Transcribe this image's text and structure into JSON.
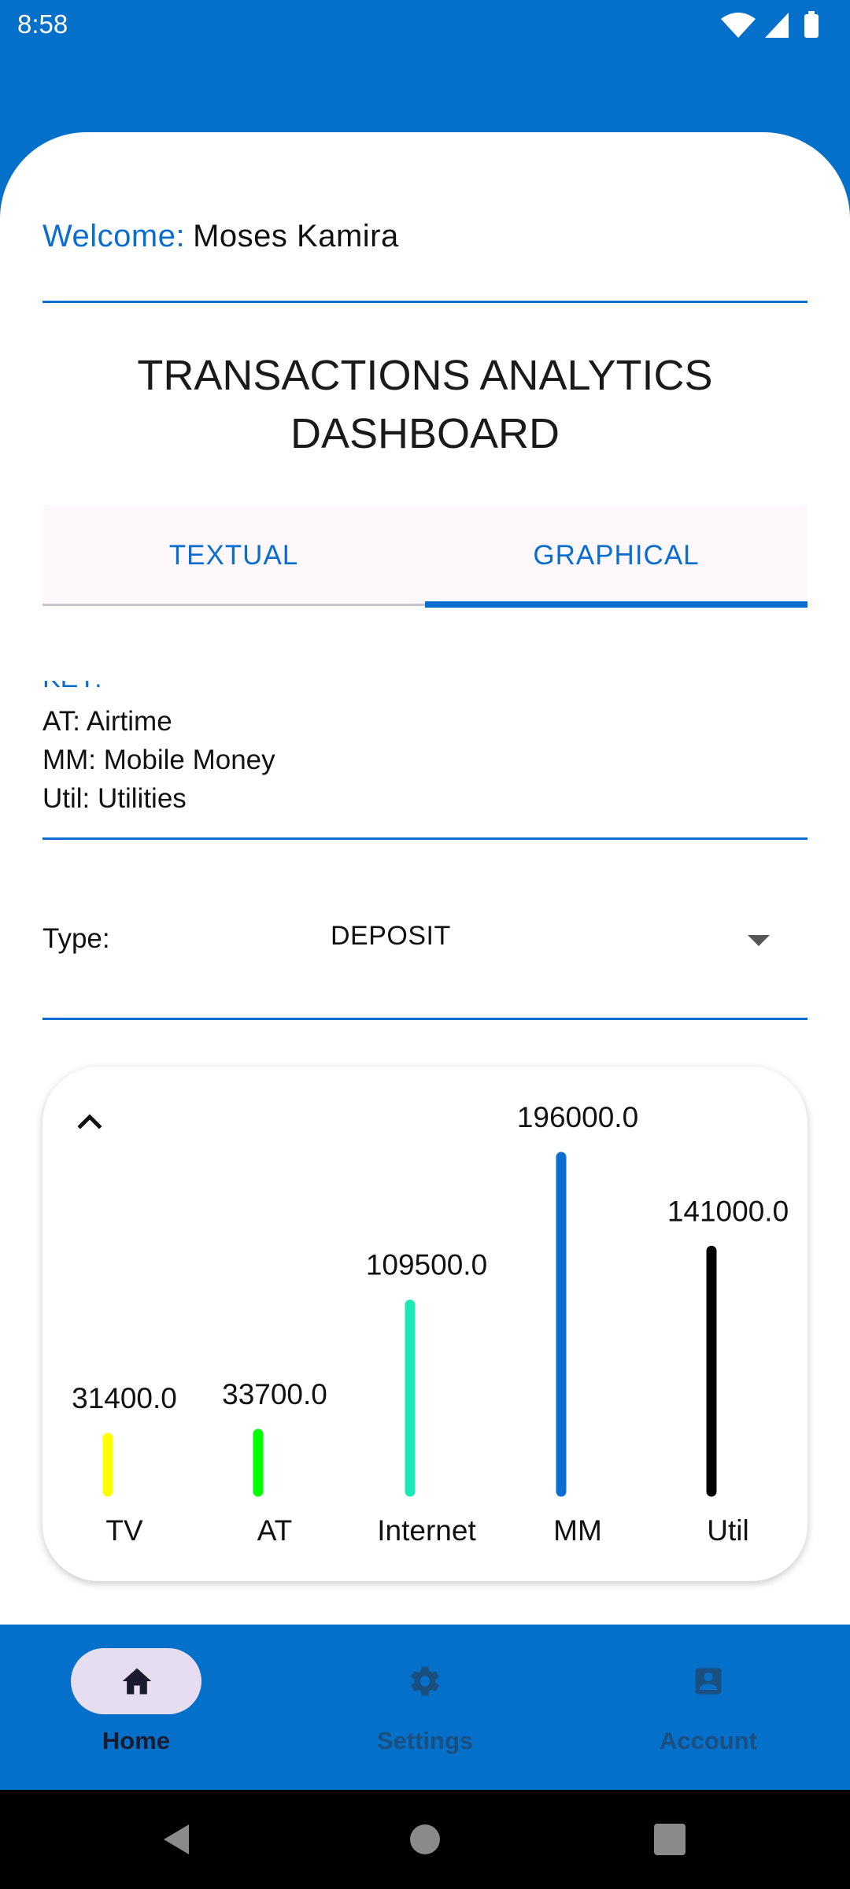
{
  "status_bar": {
    "time": "8:58",
    "icons": [
      "wifi-icon",
      "signal-icon",
      "battery-icon"
    ]
  },
  "header": {
    "welcome_label": "Welcome:",
    "user_name": "Moses Kamira"
  },
  "dashboard": {
    "title": "TRANSACTIONS ANALYTICS\nDASHBOARD"
  },
  "tabs": [
    {
      "label": "TEXTUAL",
      "selected": false
    },
    {
      "label": "GRAPHICAL",
      "selected": true
    }
  ],
  "key": {
    "title": "KEY:",
    "lines": [
      "AT: Airtime",
      "MM: Mobile Money",
      "Util: Utilities"
    ]
  },
  "type_filter": {
    "label": "Type:",
    "value": "DEPOSIT"
  },
  "chart_data": {
    "type": "bar",
    "categories": [
      "TV",
      "AT",
      "Internet",
      "MM",
      "Util"
    ],
    "values": [
      31400.0,
      33700.0,
      109500.0,
      196000.0,
      141000.0
    ],
    "value_labels": [
      "31400.0",
      "33700.0",
      "109500.0",
      "196000.0",
      "141000.0"
    ],
    "colors": [
      "#FFFF00",
      "#00FF00",
      "#1DE9B6",
      "#0A6ED1",
      "#000000"
    ],
    "ylim": [
      0,
      196000
    ],
    "grid": false,
    "legend": "none"
  },
  "bottom_nav": [
    {
      "label": "Home",
      "icon": "home-icon",
      "selected": true
    },
    {
      "label": "Settings",
      "icon": "settings-icon",
      "selected": false
    },
    {
      "label": "Account",
      "icon": "account-icon",
      "selected": false
    }
  ],
  "colors": {
    "primary": "#0570C9",
    "accent": "#0A6ED1",
    "nav_active_pill": "#E7DDF1",
    "nav_active_text": "#1B1B2F",
    "nav_inactive": "#1A4F80"
  }
}
